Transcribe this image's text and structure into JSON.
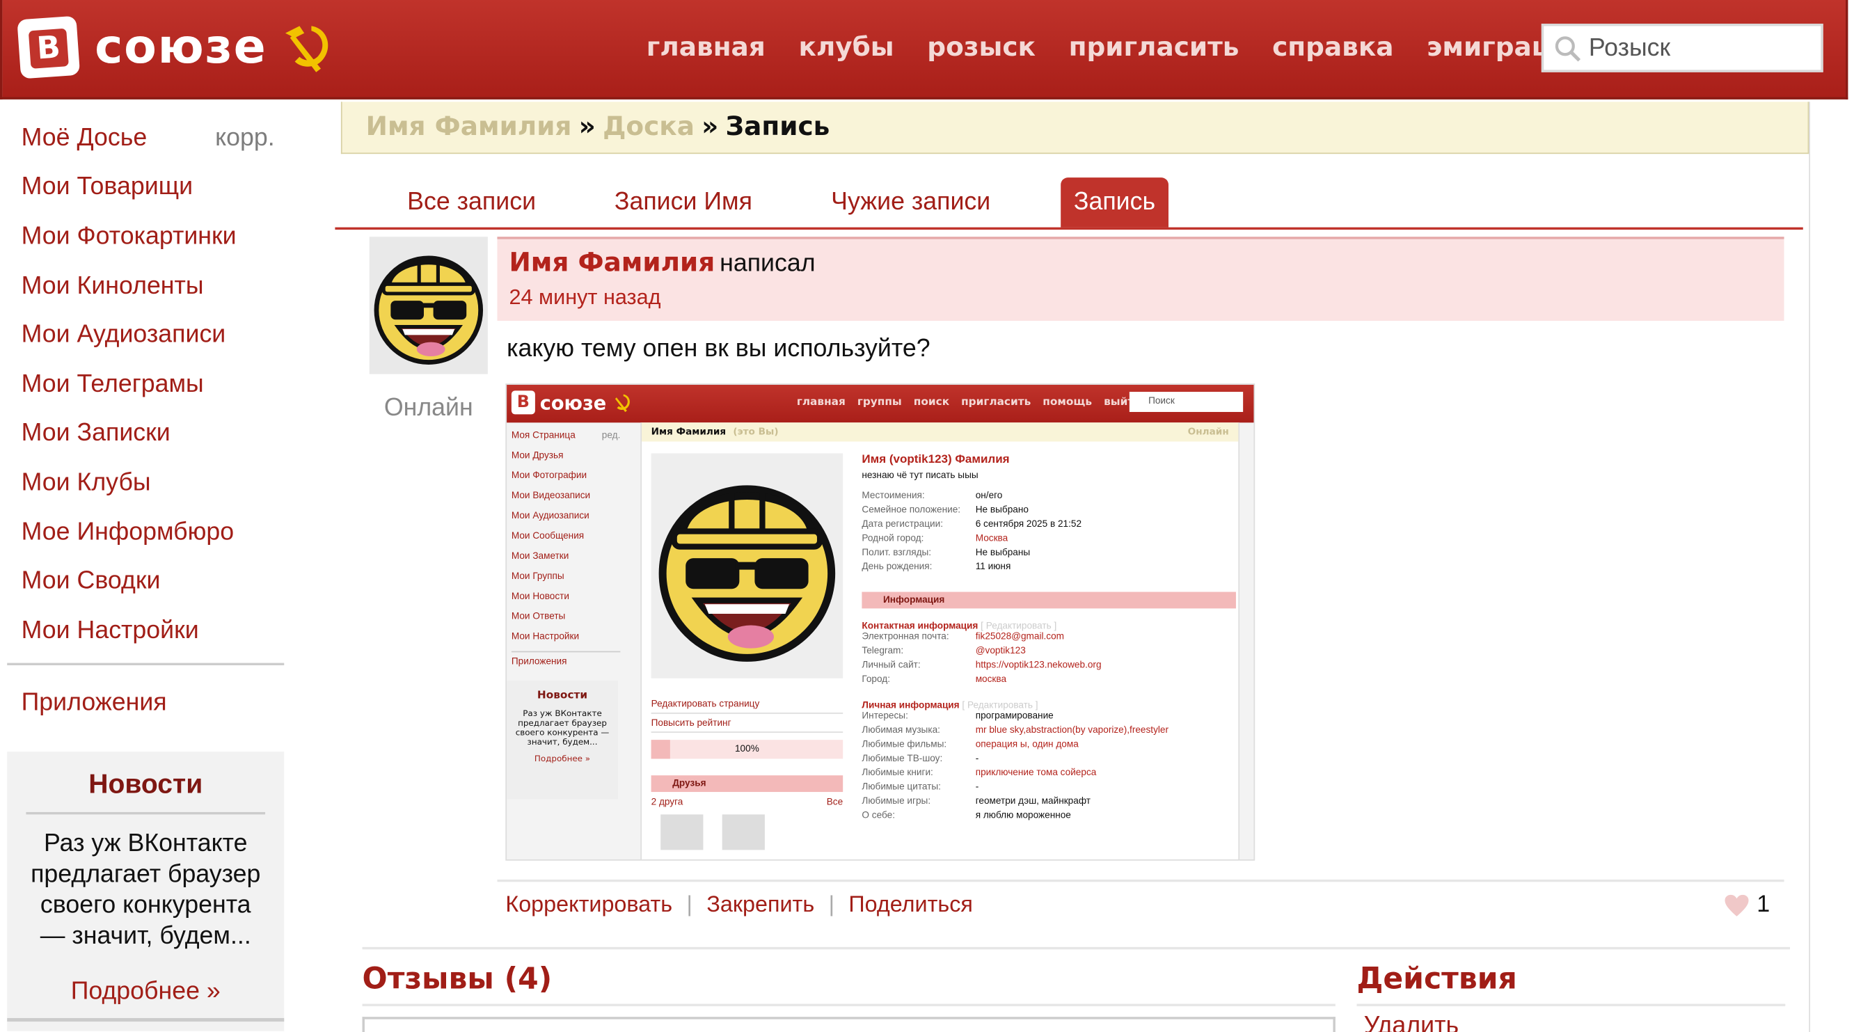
{
  "brand": {
    "logo_letter": "В",
    "name": "союзе"
  },
  "topnav": [
    "главная",
    "клубы",
    "розыск",
    "пригласить",
    "справка",
    "эмиграция"
  ],
  "search": {
    "placeholder": "Розыск"
  },
  "sidebar": {
    "items": [
      {
        "label": "Моё Досье",
        "extra": "корр."
      },
      {
        "label": "Мои Товарищи"
      },
      {
        "label": "Мои Фотокартинки"
      },
      {
        "label": "Мои Киноленты"
      },
      {
        "label": "Мои Аудиозаписи"
      },
      {
        "label": "Мои Телеграмы"
      },
      {
        "label": "Мои Записки"
      },
      {
        "label": "Мои Клубы"
      },
      {
        "label": "Мое Информбюро"
      },
      {
        "label": "Мои Сводки"
      },
      {
        "label": "Мои Настройки"
      }
    ],
    "apps": "Приложения",
    "news": {
      "title": "Новости",
      "text": "Раз уж ВКонтакте предлагает браузер своего конкурента — значит, будем...",
      "more": "Подробнее »"
    }
  },
  "breadcrumb": {
    "user": "Имя Фамилия",
    "board": "Доска",
    "sep": "»",
    "current": "Запись"
  },
  "tabs": [
    "Все записи",
    "Записи Имя",
    "Чужие записи",
    "Запись"
  ],
  "post": {
    "online": "Онлайн",
    "author": "Имя Фамилия",
    "action": "написал",
    "time": "24 минут назад",
    "text": "какую тему опен вк вы используйте?",
    "actions": [
      "Корректировать",
      "Закрепить",
      "Поделиться"
    ],
    "likes": "1"
  },
  "screenshot": {
    "logo_letter": "В",
    "logo": "союзе",
    "nav": [
      "главная",
      "группы",
      "поиск",
      "пригласить",
      "помощь",
      "выйти"
    ],
    "search": "Поиск",
    "side": [
      {
        "label": "Моя Страница",
        "extra": "ред."
      },
      {
        "label": "Мои Друзья"
      },
      {
        "label": "Мои Фотографии"
      },
      {
        "label": "Мои Видеозаписи"
      },
      {
        "label": "Мои Аудиозаписи"
      },
      {
        "label": "Мои Сообщения"
      },
      {
        "label": "Мои Заметки"
      },
      {
        "label": "Мои Группы"
      },
      {
        "label": "Мои Новости"
      },
      {
        "label": "Мои Ответы"
      },
      {
        "label": "Мои Настройки"
      },
      {
        "label": "Приложения"
      }
    ],
    "news_title": "Новости",
    "news_text": "Раз уж ВКонтакте предлагает браузер своего конкурента — значит, будем...",
    "news_more": "Подробнее »",
    "crumb": "Имя Фамилия",
    "crumb_me": "(это Вы)",
    "crumb_online": "Онлайн",
    "edit_page": "Редактировать страницу",
    "raise_rating": "Повысить рейтинг",
    "rating": "100%",
    "rating_fraction": 0.1,
    "friends": "Друзья",
    "friends_count": "2 друга",
    "friends_all": "Все",
    "name": "Имя (voptik123) Фамилия",
    "status": "незнаю чё тут писать ыыы",
    "fields": [
      {
        "k": "Местоимения:",
        "v": "он/его"
      },
      {
        "k": "Семейное положение:",
        "v": "Не выбрано"
      },
      {
        "k": "Дата регистрации:",
        "v": "6 сентября 2025 в 21:52"
      },
      {
        "k": "Родной город:",
        "v": "Москва",
        "red": true
      },
      {
        "k": "Полит. взгляды:",
        "v": "Не выбраны"
      },
      {
        "k": "День рождения:",
        "v": "11 июня"
      }
    ],
    "info": "Информация",
    "contact_title": "Контактная информация",
    "edit_link": "[ Редактировать ]",
    "contacts": [
      {
        "k": "Электронная почта:",
        "v": "fik25028@gmail.com"
      },
      {
        "k": "Telegram:",
        "v": "@voptik123"
      },
      {
        "k": "Личный сайт:",
        "v": "https://voptik123.nekoweb.org"
      },
      {
        "k": "Город:",
        "v": "москва"
      }
    ],
    "personal_title": "Личная информация",
    "personal": [
      {
        "k": "Интересы:",
        "v": "програмирование",
        "red": false
      },
      {
        "k": "Любимая музыка:",
        "v": "mr blue sky,abstraction(by vaporize),freestyler",
        "red": true
      },
      {
        "k": "Любимые фильмы:",
        "v": "операция ы, один дома",
        "red": true
      },
      {
        "k": "Любимые ТВ-шоу:",
        "v": "-",
        "red": false
      },
      {
        "k": "Любимые книги:",
        "v": "приключение тома сойерса",
        "red": true
      },
      {
        "k": "Любимые цитаты:",
        "v": "-",
        "red": false
      },
      {
        "k": "Любимые игры:",
        "v": "геометри дэш, майнкрафт",
        "red": false
      },
      {
        "k": "О себе:",
        "v": "я люблю мороженное",
        "red": false
      }
    ]
  },
  "reviews": {
    "title": "Отзывы (4)"
  },
  "actions_box": {
    "title": "Действия",
    "delete": "Удалить"
  },
  "colors": {
    "brand": "#c0332b",
    "link": "#a11e17",
    "crumb_bg": "#f9f4d8",
    "post_head_bg": "#fbe3e3"
  }
}
